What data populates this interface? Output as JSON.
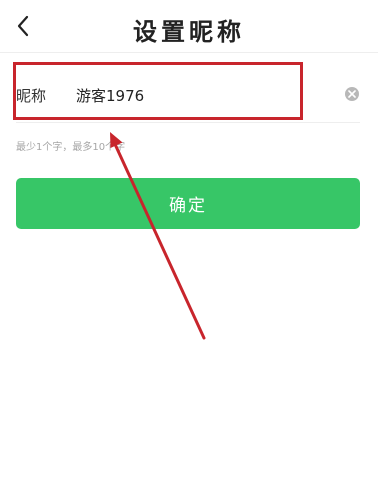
{
  "header": {
    "title": "设置昵称",
    "back_icon": "chevron-left-icon"
  },
  "form": {
    "nickname_label": "昵称",
    "nickname_value": "游客1976",
    "clear_icon": "clear-circle-icon",
    "hint": "最少1个字，最多10个字"
  },
  "actions": {
    "confirm_label": "确定"
  },
  "colors": {
    "accent": "#37c667",
    "annotation": "#c8252c",
    "hint_text": "#a6a6a6"
  }
}
